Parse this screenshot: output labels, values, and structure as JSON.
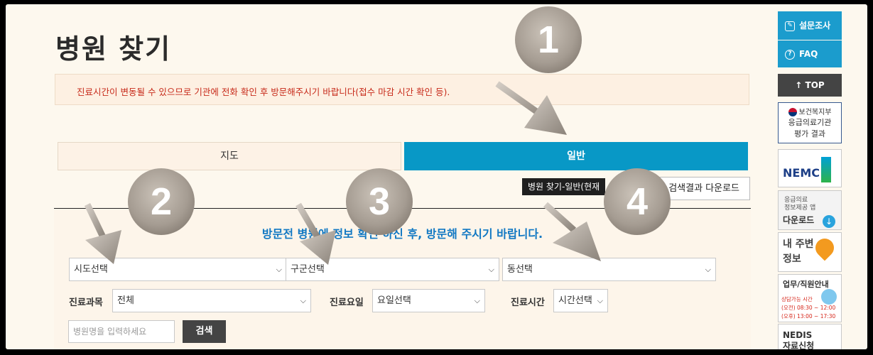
{
  "page": {
    "title": "병원 찾기",
    "notice": "진료시간이 변동될 수 있으므로 기관에 전화 확인 후 방문해주시기 바랍니다(접수 마감 시간 확인 등)."
  },
  "tabs": [
    {
      "label": "지도",
      "active": false
    },
    {
      "label": "일반",
      "active": true
    }
  ],
  "tooltip": "병원 찾기-일반(현재",
  "download_label": "검색결과 다운로드",
  "search": {
    "guide": "방문전 병원에 정보 확인 하신 후, 방문해 주시기 바랍니다.",
    "region_selects": [
      "시도선택",
      "구군선택",
      "동선택"
    ],
    "department_label": "진료과목",
    "department_value": "전체",
    "day_label": "진료요일",
    "day_value": "요일선택",
    "time_label": "진료시간",
    "time_value": "시간선택",
    "name_placeholder": "병원명을 입력하세요",
    "search_button": "검색"
  },
  "sidebar": {
    "survey": "설문조사",
    "faq": "FAQ",
    "top": "↑ TOP",
    "banner_ministry": "보건복지부",
    "banner_eval_1": "응급의료기관",
    "banner_eval_2": "평가 결과",
    "banner_nemc": "NEMC",
    "banner_app_1": "응급의료",
    "banner_app_2": "정보제공 앱",
    "banner_app_3": "다운로드",
    "banner_nearby_1": "내 주변",
    "banner_nearby_2": "정보",
    "banner_staff": "업무/직원안내",
    "banner_staff_sub_1": "상담가능 시간",
    "banner_staff_sub_2": "(오전) 08:30 ~ 12:00",
    "banner_staff_sub_3": "(오후) 13:00 ~ 17:30",
    "banner_nedis_1": "NEDIS",
    "banner_nedis_2": "자료신청"
  },
  "annotations": [
    "1",
    "2",
    "3",
    "4"
  ],
  "colors": {
    "accent_blue": "#0898c6",
    "notice_red": "#c72a1a",
    "guide_blue": "#1178c3",
    "page_bg": "#fdf8ee"
  }
}
